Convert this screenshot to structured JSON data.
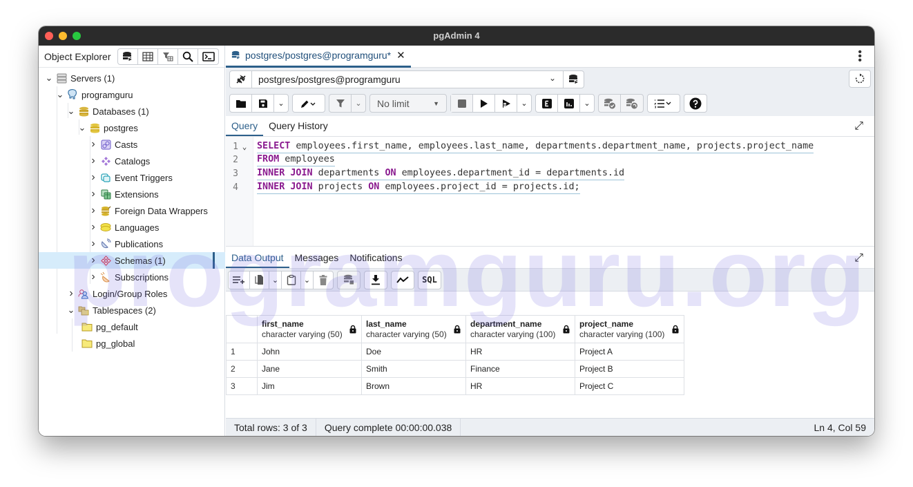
{
  "window": {
    "title": "pgAdmin 4",
    "traffic_lights": {
      "close": "#ff5f57",
      "minimize": "#febc2e",
      "zoom": "#28c840"
    }
  },
  "object_explorer": {
    "label": "Object Explorer",
    "tools": [
      "database-query-icon",
      "table-view-icon",
      "filter-table-icon",
      "search-icon",
      "terminal-icon"
    ],
    "tree": [
      {
        "label": "Servers (1)",
        "icon": "servers-icon",
        "expanded": true,
        "level": 0
      },
      {
        "label": "programguru",
        "icon": "postgres-elephant-icon",
        "expanded": true,
        "level": 1
      },
      {
        "label": "Databases (1)",
        "icon": "databases-icon",
        "expanded": true,
        "level": 2
      },
      {
        "label": "postgres",
        "icon": "database-icon",
        "expanded": true,
        "level": 3
      },
      {
        "label": "Casts",
        "icon": "casts-icon",
        "expanded": false,
        "level": 4
      },
      {
        "label": "Catalogs",
        "icon": "catalogs-icon",
        "expanded": false,
        "level": 4
      },
      {
        "label": "Event Triggers",
        "icon": "event-triggers-icon",
        "expanded": false,
        "level": 4
      },
      {
        "label": "Extensions",
        "icon": "extensions-icon",
        "expanded": false,
        "level": 4
      },
      {
        "label": "Foreign Data Wrappers",
        "icon": "foreign-data-wrappers-icon",
        "expanded": false,
        "level": 4
      },
      {
        "label": "Languages",
        "icon": "languages-icon",
        "expanded": false,
        "level": 4
      },
      {
        "label": "Publications",
        "icon": "publications-icon",
        "expanded": false,
        "level": 4
      },
      {
        "label": "Schemas (1)",
        "icon": "schemas-icon",
        "expanded": false,
        "level": 4,
        "selected": true
      },
      {
        "label": "Subscriptions",
        "icon": "subscriptions-icon",
        "expanded": false,
        "level": 4
      },
      {
        "label": "Login/Group Roles",
        "icon": "roles-icon",
        "expanded": false,
        "level": 2
      },
      {
        "label": "Tablespaces (2)",
        "icon": "tablespaces-icon",
        "expanded": true,
        "level": 2
      },
      {
        "label": "pg_default",
        "icon": "folder-icon",
        "level": 3,
        "leaf": true
      },
      {
        "label": "pg_global",
        "icon": "folder-icon",
        "level": 3,
        "leaf": true
      }
    ]
  },
  "query_tab": {
    "label": "postgres/postgres@programguru*",
    "close": "✕"
  },
  "connection": {
    "value": "postgres/postgres@programguru"
  },
  "toolbar": {
    "limit_label": "No limit"
  },
  "editor_tabs": {
    "query": "Query",
    "history": "Query History"
  },
  "sql": {
    "lines": [
      {
        "num": "1",
        "tokens": [
          {
            "t": "SELECT",
            "kw": true
          },
          {
            "t": " employees.first_name, employees.last_name, departments.department_name, projects.project_name"
          }
        ]
      },
      {
        "num": "2",
        "tokens": [
          {
            "t": "FROM",
            "kw": true
          },
          {
            "t": " employees"
          }
        ]
      },
      {
        "num": "3",
        "tokens": [
          {
            "t": "INNER JOIN",
            "kw": true
          },
          {
            "t": " departments "
          },
          {
            "t": "ON",
            "kw": true
          },
          {
            "t": " employees.department_id = departments.id"
          }
        ]
      },
      {
        "num": "4",
        "tokens": [
          {
            "t": "INNER JOIN",
            "kw": true
          },
          {
            "t": " projects "
          },
          {
            "t": "ON",
            "kw": true
          },
          {
            "t": " employees.project_id = projects.id;"
          }
        ]
      }
    ]
  },
  "output_tabs": {
    "data_output": "Data Output",
    "messages": "Messages",
    "notifications": "Notifications"
  },
  "result": {
    "columns": [
      {
        "name": "first_name",
        "type": "character varying (50)"
      },
      {
        "name": "last_name",
        "type": "character varying (50)"
      },
      {
        "name": "department_name",
        "type": "character varying (100)"
      },
      {
        "name": "project_name",
        "type": "character varying (100)"
      }
    ],
    "rows": [
      {
        "n": "1",
        "cells": [
          "John",
          "Doe",
          "HR",
          "Project A"
        ]
      },
      {
        "n": "2",
        "cells": [
          "Jane",
          "Smith",
          "Finance",
          "Project B"
        ]
      },
      {
        "n": "3",
        "cells": [
          "Jim",
          "Brown",
          "HR",
          "Project C"
        ]
      }
    ]
  },
  "status": {
    "total_rows": "Total rows: 3 of 3",
    "query_time": "Query complete 00:00:00.038",
    "cursor": "Ln 4, Col 59"
  },
  "watermark": "programguru.org",
  "colors": {
    "accent": "#2c5f8a",
    "keyword": "#8a1a8f",
    "selection": "#d6ecfb"
  }
}
